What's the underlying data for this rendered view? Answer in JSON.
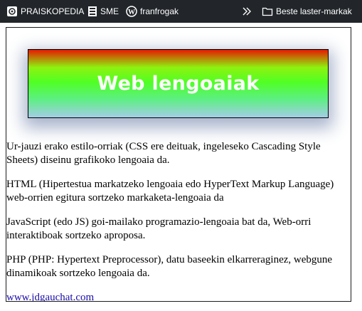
{
  "bookmarks_bar": {
    "items": [
      {
        "label": "PRAISKOPEDIA",
        "icon": "praiskopedia-favicon"
      },
      {
        "label": "SME",
        "icon": "document-favicon"
      },
      {
        "label": "franfrogak",
        "icon": "wordpress-icon"
      }
    ],
    "overflow_icon": "chevron-double-right-icon",
    "other_bookmarks": {
      "label": "Beste laster-markak",
      "icon": "folder-icon"
    }
  },
  "page": {
    "banner_title": "Web lengoaiak",
    "paragraphs": [
      "Ur-jauzi erako estilo-orriak (CSS ere deituak, ingeleseko Cascading Style Sheets) diseinu grafikoko lengoaia da.",
      "HTML (Hipertestua markatzeko lengoaia edo HyperText Markup Language) web-orrien egitura sortzeko markaketa-lengoaia da",
      "JavaScript (edo JS) goi-mailako programazio-lengoaia bat da, Web-orri interaktiboak sortzeko aproposa.",
      "PHP (PHP: Hypertext Preprocessor), datu baseekin elkarreraginez, webgune dinamikoak sortzeko lengoaia da."
    ],
    "link_text": "www.jdgauchat.com"
  },
  "colors": {
    "bookmarks_bar_bg": "#22262b",
    "banner_gradient": [
      "#e51a00",
      "#8ef20f",
      "#50ff24",
      "#5cf07f",
      "#a3cde6"
    ],
    "banner_shadow": "#a8b4cc",
    "link": "#1a0dab"
  }
}
